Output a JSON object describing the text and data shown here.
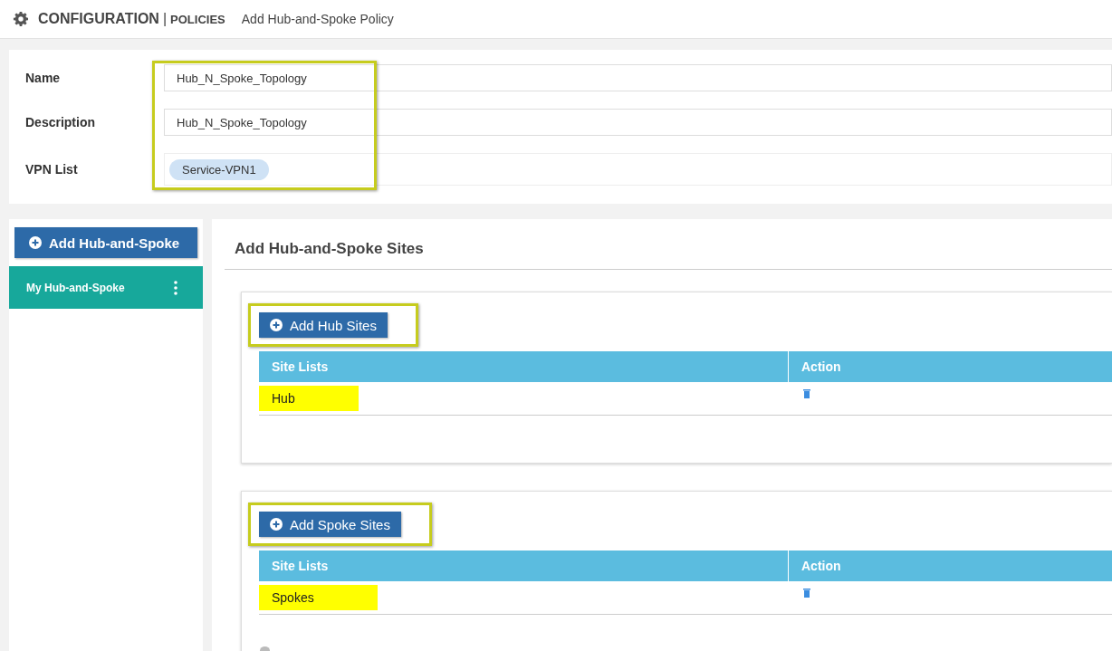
{
  "header": {
    "title": "CONFIGURATION",
    "separator": "|",
    "subtitle": "POLICIES",
    "page_title": "Add Hub-and-Spoke Policy"
  },
  "form": {
    "highlighted": true,
    "fields": [
      {
        "label": "Name",
        "kind": "text",
        "value": "Hub_N_Spoke_Topology"
      },
      {
        "label": "Description",
        "kind": "text",
        "value": "Hub_N_Spoke_Topology"
      },
      {
        "label": "VPN List",
        "kind": "tags",
        "tags": [
          "Service-VPN1"
        ]
      }
    ]
  },
  "sidebar": {
    "add_button": "Add Hub-and-Spoke",
    "items": [
      {
        "label": "My Hub-and-Spoke",
        "selected": true
      }
    ]
  },
  "main": {
    "title": "Add Hub-and-Spoke Sites",
    "groups": [
      {
        "button": "Add Hub Sites",
        "button_highlighted": true,
        "columns": [
          "Site Lists",
          "Action"
        ],
        "rows": [
          {
            "site_list": "Hub",
            "highlighted": true
          }
        ],
        "footer_dot": false
      },
      {
        "button": "Add Spoke Sites",
        "button_highlighted": true,
        "columns": [
          "Site Lists",
          "Action"
        ],
        "rows": [
          {
            "site_list": "Spokes",
            "highlighted": true
          }
        ],
        "footer_dot": true
      }
    ]
  }
}
